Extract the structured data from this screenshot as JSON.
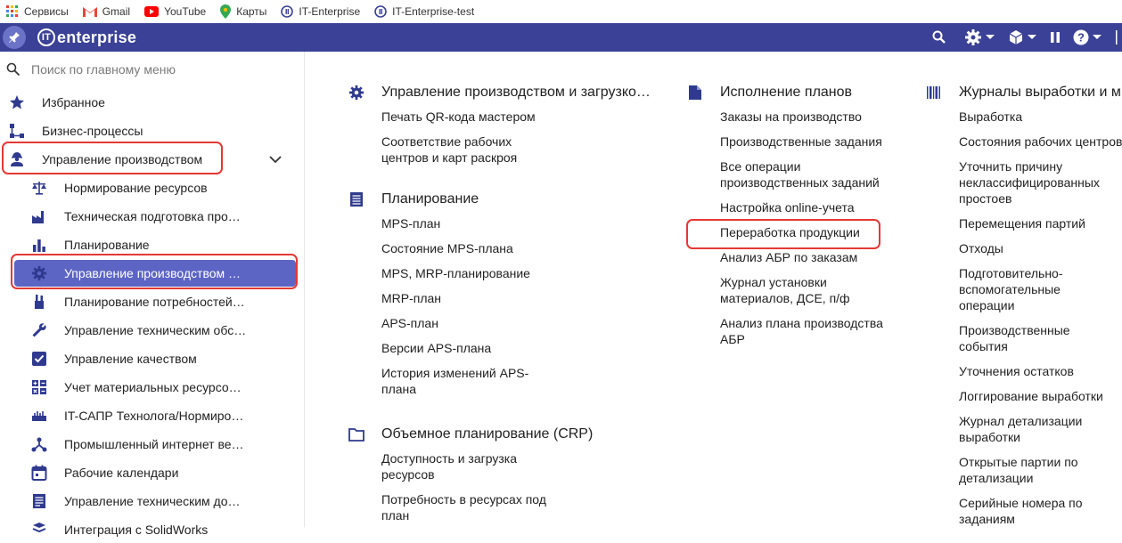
{
  "bookmarks": [
    {
      "label": "Сервисы",
      "icon": "apps-grid-icon"
    },
    {
      "label": "Gmail",
      "icon": "gmail-icon"
    },
    {
      "label": "YouTube",
      "icon": "youtube-icon"
    },
    {
      "label": "Карты",
      "icon": "maps-pin-icon"
    },
    {
      "label": "IT-Enterprise",
      "icon": "it-enterprise-icon"
    },
    {
      "label": "IT-Enterprise-test",
      "icon": "it-enterprise-icon"
    }
  ],
  "app": {
    "logo_text": "enterprise",
    "logo_mark": "IT"
  },
  "search": {
    "placeholder": "Поиск по главному меню"
  },
  "sidebar": {
    "top_items": [
      {
        "label": "Избранное",
        "icon": "star-icon"
      },
      {
        "label": "Бизнес-процессы",
        "icon": "workflow-icon"
      },
      {
        "label": "Управление производством",
        "icon": "worker-icon"
      }
    ],
    "sub_items": [
      {
        "label": "Нормирование ресурсов",
        "icon": "scales-icon"
      },
      {
        "label": "Техническая подготовка про…",
        "icon": "factory-icon"
      },
      {
        "label": "Планирование",
        "icon": "bar-chart-icon"
      },
      {
        "label": "Управление производством …",
        "icon": "gear-icon"
      },
      {
        "label": "Планирование потребностей…",
        "icon": "tools-icon"
      },
      {
        "label": "Управление техническим обс…",
        "icon": "wrench-icon"
      },
      {
        "label": "Управление качеством",
        "icon": "checkbox-icon"
      },
      {
        "label": "Учет материальных ресурсо…",
        "icon": "calculator-icon"
      },
      {
        "label": "IT-САПР Технолога/Нормиро…",
        "icon": "ruler-icon"
      },
      {
        "label": "Промышленный интернет ве…",
        "icon": "network-icon"
      },
      {
        "label": "Рабочие календари",
        "icon": "calendar-icon"
      },
      {
        "label": "Управление техническим до…",
        "icon": "document-icon"
      },
      {
        "label": "Интеграция с SolidWorks",
        "icon": "integration-icon"
      }
    ]
  },
  "columns": [
    {
      "groups": [
        {
          "title": "Управление производством и загрузко…",
          "icon": "gear-icon",
          "links": [
            "Печать QR-кода мастером",
            "Соответствие рабочих центров и карт раскроя"
          ]
        },
        {
          "title": "Планирование",
          "icon": "list-doc-icon",
          "links": [
            "MPS-план",
            "Состояние MPS-плана",
            "MPS, MRP-планирование",
            "MRP-план",
            "APS-план",
            "Версии APS-плана",
            "История изменений APS-плана"
          ]
        },
        {
          "title": "Объемное планирование (CRP)",
          "icon": "folder-icon",
          "links": [
            "Доступность и загрузка ресурсов",
            "Потребность в ресурсах под план"
          ]
        }
      ]
    },
    {
      "groups": [
        {
          "title": "Исполнение планов",
          "icon": "file-icon",
          "links": [
            "Заказы на производство",
            "Производственные задания",
            "Все операции производственных заданий",
            "Настройка online-учета",
            "Переработка продукции",
            "Анализ АБР по заказам",
            "Журнал установки материалов, ДСЕ, п/ф",
            "Анализ плана производства АБР"
          ]
        }
      ]
    },
    {
      "groups": [
        {
          "title": "Журналы выработки и м",
          "icon": "barcode-icon",
          "links": [
            "Выработка",
            "Состояния рабочих центров",
            "Уточнить причину неклассифицированных простоев",
            "Перемещения партий",
            "Отходы",
            "Подготовительно-вспомогательные операции",
            "Производственные события",
            "Уточнения остатков",
            "Логгирование выработки",
            "Журнал детализации выработки",
            "Открытые партии по детализации",
            "Серийные номера по заданиям"
          ]
        }
      ]
    }
  ],
  "colors": {
    "topbar": "#3a4196",
    "active": "#5c64c4",
    "highlight": "#e53935",
    "icon": "#2f3a8f"
  }
}
